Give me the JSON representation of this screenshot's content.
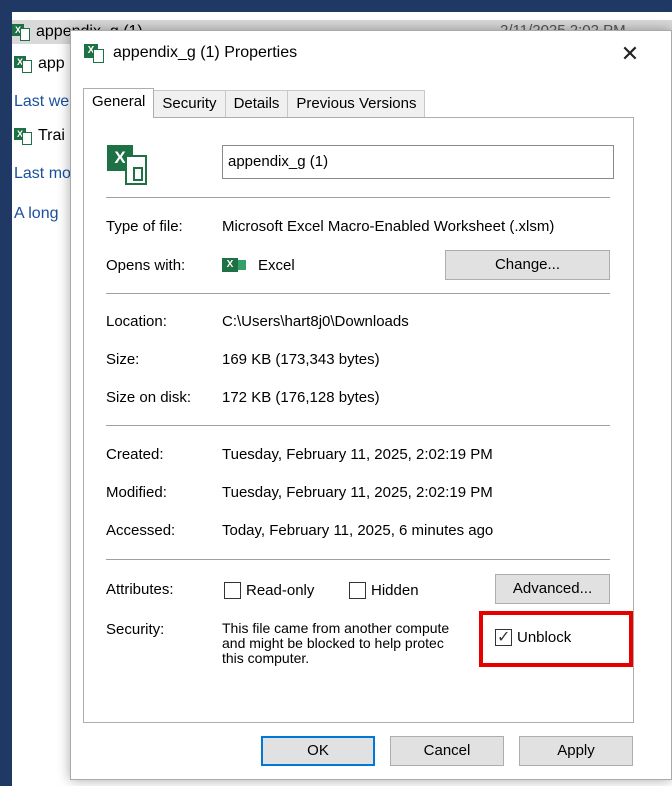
{
  "explorer": {
    "rows": [
      {
        "name": "appendix_g (1)",
        "date": "2/11/2025 2:02 PM"
      },
      {
        "name": "app"
      },
      {
        "group": "Last we"
      },
      {
        "name": "Trai"
      },
      {
        "group": "Last mo"
      },
      {
        "group": "A long"
      }
    ],
    "side_marker": "1"
  },
  "dialog": {
    "title": "appendix_g (1) Properties",
    "close_label": "✕",
    "tabs": [
      "General",
      "Security",
      "Details",
      "Previous Versions"
    ],
    "active_tab": "General",
    "filename": "appendix_g (1)",
    "type_label": "Type of file:",
    "type_value": "Microsoft Excel Macro-Enabled Worksheet (.xlsm)",
    "opens_label": "Opens with:",
    "opens_value": "Excel",
    "change_button": "Change...",
    "location_label": "Location:",
    "location_value": "C:\\Users\\hart8j0\\Downloads",
    "size_label": "Size:",
    "size_value": "169 KB (173,343 bytes)",
    "size_disk_label": "Size on disk:",
    "size_disk_value": "172 KB (176,128 bytes)",
    "created_label": "Created:",
    "created_value": "Tuesday, February 11, 2025, 2:02:19 PM",
    "modified_label": "Modified:",
    "modified_value": "Tuesday, February 11, 2025, 2:02:19 PM",
    "accessed_label": "Accessed:",
    "accessed_value": "Today, February 11, 2025, 6 minutes ago",
    "attributes_label": "Attributes:",
    "readonly_label": "Read-only",
    "readonly_checked": false,
    "hidden_label": "Hidden",
    "hidden_checked": false,
    "advanced_button": "Advanced...",
    "security_label": "Security:",
    "security_text_1": "This file came from another compute",
    "security_text_2": "and might be blocked to help protec",
    "security_text_3": "this computer.",
    "unblock_label": "Unblock",
    "unblock_checked": true,
    "ok_button": "OK",
    "cancel_button": "Cancel",
    "apply_button": "Apply"
  },
  "colors": {
    "highlight": "#e60000",
    "excel_green": "#1e7145",
    "focus_blue": "#0078d7"
  }
}
